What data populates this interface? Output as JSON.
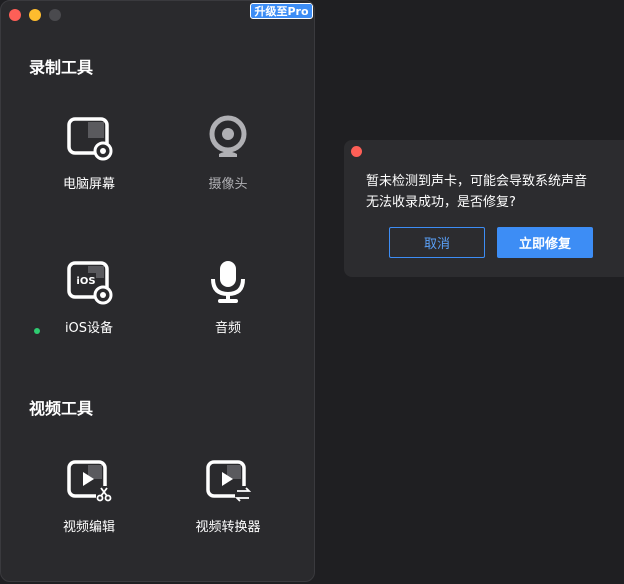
{
  "app": {
    "upgrade_label": "升级至Pro"
  },
  "recording": {
    "title": "录制工具",
    "tools": [
      {
        "label": "电脑屏幕",
        "icon": "screen-record-icon"
      },
      {
        "label": "摄像头",
        "icon": "webcam-icon"
      },
      {
        "label": "iOS设备",
        "icon": "ios-device-icon",
        "status": "connected"
      },
      {
        "label": "音频",
        "icon": "microphone-icon"
      }
    ]
  },
  "video": {
    "title": "视频工具",
    "tools": [
      {
        "label": "视频编辑",
        "icon": "video-edit-icon"
      },
      {
        "label": "视频转换器",
        "icon": "video-convert-icon"
      }
    ]
  },
  "dialog": {
    "message_line1": "暂未检测到声卡，可能会导致系统声音",
    "message_line2": "无法收录成功，是否修复?",
    "cancel_label": "取消",
    "fix_label": "立即修复"
  },
  "colors": {
    "accent": "#3d8df5",
    "status_green": "#2ecc71",
    "close_red": "#fe5f57"
  }
}
